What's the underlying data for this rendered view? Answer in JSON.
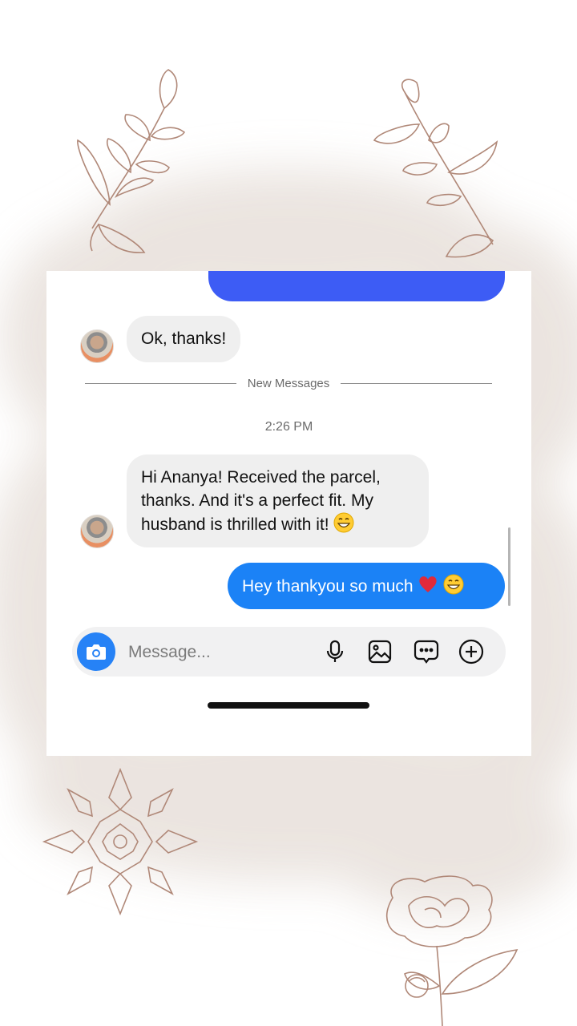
{
  "messages": [
    {
      "direction": "incoming",
      "text": "Ok, thanks!"
    },
    {
      "direction": "incoming",
      "text": "Hi Ananya! Received the parcel, thanks. And it's a perfect fit. My husband is thrilled with it!",
      "emoji": "grinning-face"
    },
    {
      "direction": "outgoing",
      "text": "Hey thankyou so much",
      "emoji": [
        "red-heart",
        "grinning-face"
      ]
    }
  ],
  "divider_label": "New Messages",
  "timestamp": "2:26 PM",
  "composer": {
    "placeholder": "Message...",
    "icons": [
      "camera-icon",
      "microphone-icon",
      "gallery-icon",
      "sticker-icon",
      "plus-icon"
    ]
  },
  "colors": {
    "outgoing_bubble": "#1b82f6",
    "incoming_bubble": "#efefef",
    "camera_button": "#2682f6",
    "decoration_stroke": "#b08878"
  }
}
